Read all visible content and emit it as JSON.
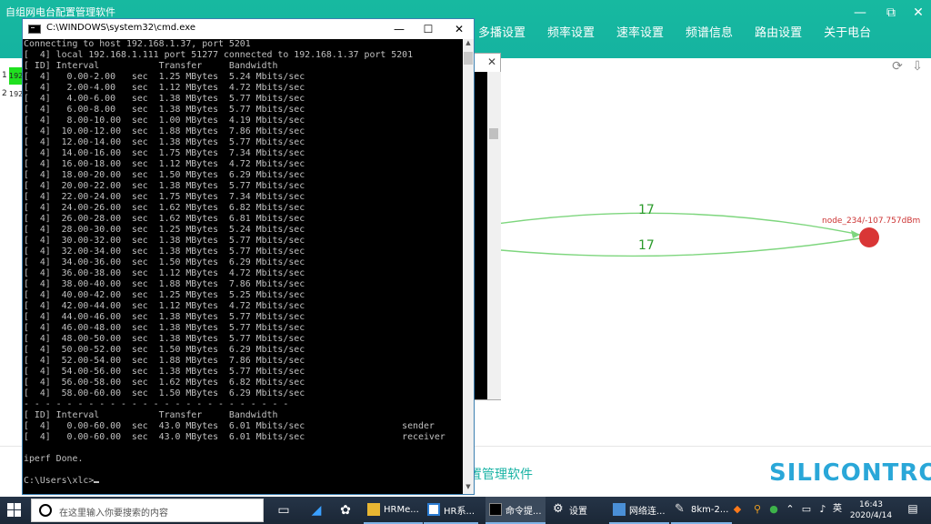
{
  "app": {
    "title": "自组网电台配置管理软件",
    "nav": [
      "多播设置",
      "频率设置",
      "速率设置",
      "频谱信息",
      "路由设置",
      "关于电台"
    ],
    "left_list": [
      {
        "index": "1",
        "ip": "192",
        "active": true
      },
      {
        "index": "2",
        "ip": "192",
        "active": false
      }
    ],
    "topology": {
      "links": [
        {
          "label": "17"
        },
        {
          "label": "17"
        }
      ],
      "node_label": "node_234/-107.757dBm",
      "node_color": "#d93636",
      "link_color": "#7ed67e"
    },
    "footer_text": "置管理软件",
    "brand": "SILICONTROL",
    "accent": "#17b9a0"
  },
  "cmd": {
    "title": "C:\\WINDOWS\\system32\\cmd.exe",
    "lines": [
      "Connecting to host 192.168.1.37, port 5201",
      "[  4] local 192.168.1.111 port 51277 connected to 192.168.1.37 port 5201",
      "[ ID] Interval           Transfer     Bandwidth",
      "[  4]   0.00-2.00   sec  1.25 MBytes  5.24 Mbits/sec",
      "[  4]   2.00-4.00   sec  1.12 MBytes  4.72 Mbits/sec",
      "[  4]   4.00-6.00   sec  1.38 MBytes  5.77 Mbits/sec",
      "[  4]   6.00-8.00   sec  1.38 MBytes  5.77 Mbits/sec",
      "[  4]   8.00-10.00  sec  1.00 MBytes  4.19 Mbits/sec",
      "[  4]  10.00-12.00  sec  1.88 MBytes  7.86 Mbits/sec",
      "[  4]  12.00-14.00  sec  1.38 MBytes  5.77 Mbits/sec",
      "[  4]  14.00-16.00  sec  1.75 MBytes  7.34 Mbits/sec",
      "[  4]  16.00-18.00  sec  1.12 MBytes  4.72 Mbits/sec",
      "[  4]  18.00-20.00  sec  1.50 MBytes  6.29 Mbits/sec",
      "[  4]  20.00-22.00  sec  1.38 MBytes  5.77 Mbits/sec",
      "[  4]  22.00-24.00  sec  1.75 MBytes  7.34 Mbits/sec",
      "[  4]  24.00-26.00  sec  1.62 MBytes  6.82 Mbits/sec",
      "[  4]  26.00-28.00  sec  1.62 MBytes  6.81 Mbits/sec",
      "[  4]  28.00-30.00  sec  1.25 MBytes  5.24 Mbits/sec",
      "[  4]  30.00-32.00  sec  1.38 MBytes  5.77 Mbits/sec",
      "[  4]  32.00-34.00  sec  1.38 MBytes  5.77 Mbits/sec",
      "[  4]  34.00-36.00  sec  1.50 MBytes  6.29 Mbits/sec",
      "[  4]  36.00-38.00  sec  1.12 MBytes  4.72 Mbits/sec",
      "[  4]  38.00-40.00  sec  1.88 MBytes  7.86 Mbits/sec",
      "[  4]  40.00-42.00  sec  1.25 MBytes  5.25 Mbits/sec",
      "[  4]  42.00-44.00  sec  1.12 MBytes  4.72 Mbits/sec",
      "[  4]  44.00-46.00  sec  1.38 MBytes  5.77 Mbits/sec",
      "[  4]  46.00-48.00  sec  1.38 MBytes  5.77 Mbits/sec",
      "[  4]  48.00-50.00  sec  1.38 MBytes  5.77 Mbits/sec",
      "[  4]  50.00-52.00  sec  1.50 MBytes  6.29 Mbits/sec",
      "[  4]  52.00-54.00  sec  1.88 MBytes  7.86 Mbits/sec",
      "[  4]  54.00-56.00  sec  1.38 MBytes  5.77 Mbits/sec",
      "[  4]  56.00-58.00  sec  1.62 MBytes  6.82 Mbits/sec",
      "[  4]  58.00-60.00  sec  1.50 MBytes  6.29 Mbits/sec",
      "- - - - - - - - - - - - - - - - - - - - - - - - -",
      "[ ID] Interval           Transfer     Bandwidth",
      "[  4]   0.00-60.00  sec  43.0 MBytes  6.01 Mbits/sec                  sender",
      "[  4]   0.00-60.00  sec  43.0 MBytes  6.01 Mbits/sec                  receiver",
      "",
      "iperf Done.",
      "",
      "C:\\Users\\xlc>"
    ]
  },
  "taskbar": {
    "search_placeholder": "在这里输入你要搜索的内容",
    "apps": [
      {
        "label": "HRMe...",
        "active": false
      },
      {
        "label": "HR系...",
        "active": false
      },
      {
        "label": "命令提...",
        "active": true
      },
      {
        "label": "设置",
        "active": false
      },
      {
        "label": "网络连...",
        "active": false
      },
      {
        "label": "8km-2...",
        "active": false
      }
    ],
    "ime": "英",
    "time": "16:43",
    "date": "2020/4/14"
  }
}
